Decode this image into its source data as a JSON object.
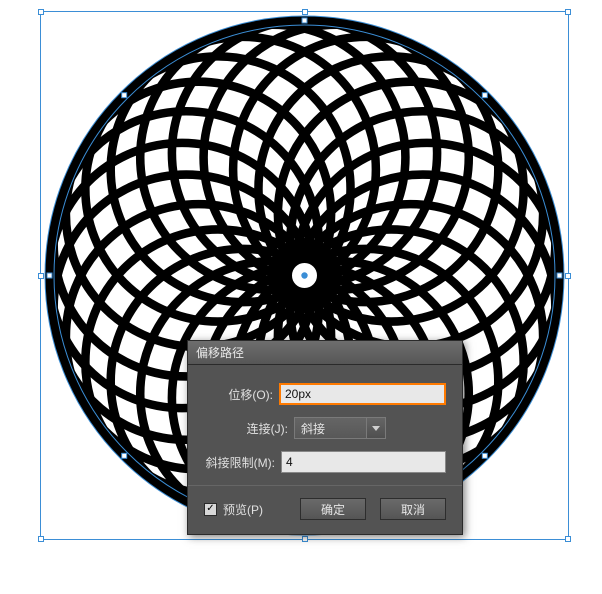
{
  "dialog": {
    "title": "偏移路径",
    "offset_label": "位移(O):",
    "offset_value": "20px",
    "join_label": "连接(J):",
    "join_value": "斜接",
    "miterlimit_label": "斜接限制(M):",
    "miterlimit_value": "4",
    "preview_label": "预览(P)",
    "preview_checked": true,
    "ok_label": "确定",
    "cancel_label": "取消"
  },
  "artwork": {
    "petals": 24,
    "stroke": "#000",
    "stroke_width": 9,
    "selection_color": "#3b8ed6"
  }
}
